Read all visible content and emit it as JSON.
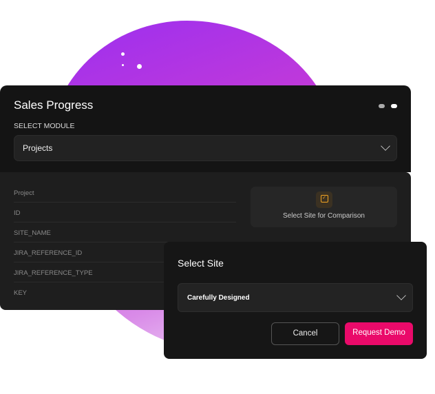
{
  "panel": {
    "title": "Sales Progress",
    "module_label": "SELECT MODULE",
    "module_value": "Projects"
  },
  "fields": [
    "Project",
    "ID",
    "SITE_NAME",
    "JIRA_REFERENCE_ID",
    "JIRA_REFERENCE_TYPE",
    "KEY"
  ],
  "compare": {
    "label": "Select Site for Comparison",
    "icon": "checkbox-stack-icon"
  },
  "modal": {
    "title": "Select Site",
    "value": "Carefully Designed",
    "cancel": "Cancel",
    "submit": "Request Demo"
  },
  "colors": {
    "accent": "#ea0a6a",
    "icon": "#f5a623"
  }
}
